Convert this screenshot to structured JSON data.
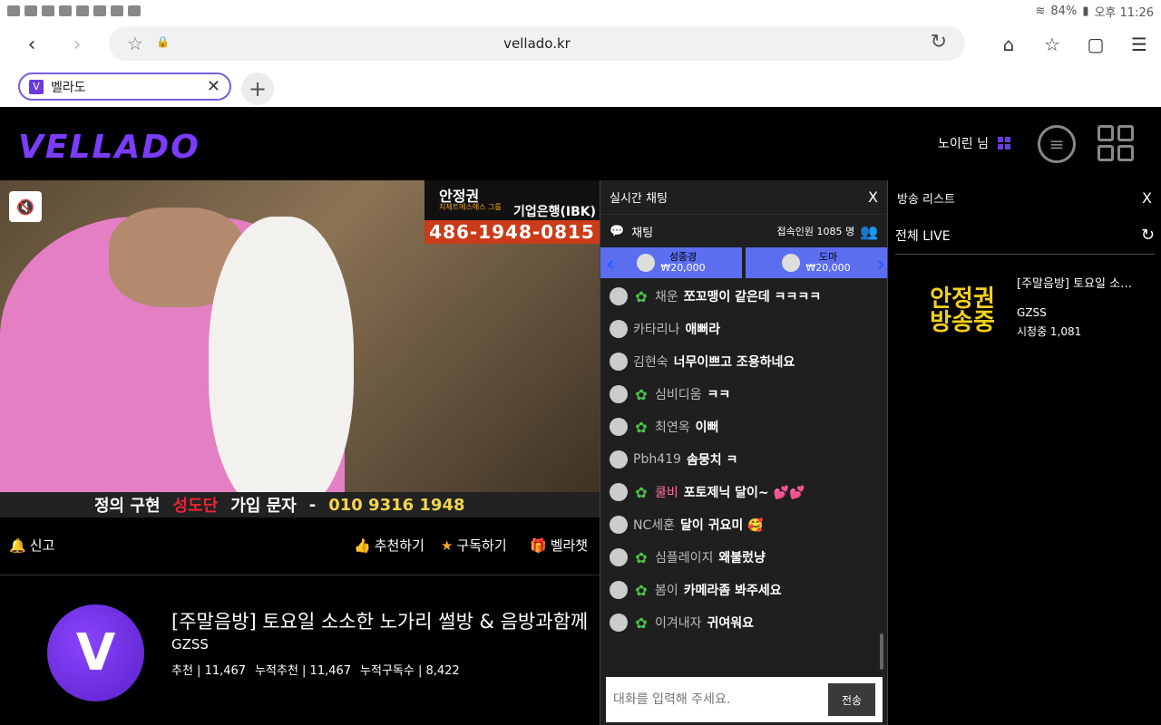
{
  "statusbar": {
    "battery": "84%",
    "time": "오후 11:26"
  },
  "browser": {
    "url": "vellado.kr"
  },
  "tab": {
    "title": "벨라도",
    "favicon": "V"
  },
  "header": {
    "logo": "VELLADO",
    "user": "노이린 님"
  },
  "video": {
    "banner_name": "안정권",
    "banner_sub": "지제트에스에스 그룹",
    "banner_bank": "기업은행(IBK)",
    "banner_phone": "486-1948-0815",
    "bottom_parts": [
      "정의 구현",
      "성도단",
      "가입 문자",
      "-",
      "010  9316  1948"
    ]
  },
  "actions": {
    "report": "신고",
    "recommend": "추천하기",
    "subscribe": "구독하기",
    "gift": "벨라챗"
  },
  "info": {
    "title": "[주말음방] 토요일 소소한 노가리 썰방 & 음방과함께",
    "channel": "GZSS",
    "stats": [
      "추천 | 11,467",
      "누적추천 | 11,467",
      "누적구독수 | 8,422"
    ]
  },
  "chat": {
    "title": "실시간 채팅",
    "close": "X",
    "sub_label": "채팅",
    "count": "접속인원 1085 명",
    "donors": [
      {
        "name": "성종경",
        "amount": "₩20,000"
      },
      {
        "name": "도마",
        "amount": "₩20,000"
      }
    ],
    "messages": [
      {
        "name": "채운",
        "text": "쪼꼬맹이 같은데 ㅋㅋㅋㅋ",
        "badge": true,
        "pink": false
      },
      {
        "name": "카타리나",
        "text": "애뻐라",
        "badge": false,
        "pink": false
      },
      {
        "name": "김현숙",
        "text": "너무이쁘고 조용하네요",
        "badge": false,
        "pink": false
      },
      {
        "name": "심비디움",
        "text": "ㅋㅋ",
        "badge": true,
        "pink": false
      },
      {
        "name": "최연옥",
        "text": "이뻐",
        "badge": true,
        "pink": false
      },
      {
        "name": "Pbh419",
        "text": "솜뭉치 ㅋ",
        "badge": false,
        "pink": false
      },
      {
        "name": "쿨비",
        "text": "포토제닉 달이~ 💕💕",
        "badge": true,
        "pink": true
      },
      {
        "name": "NC세훈",
        "text": "달이 귀요미 🥰",
        "badge": false,
        "pink": false
      },
      {
        "name": "심플레이지",
        "text": "왜불렀냥",
        "badge": true,
        "pink": false
      },
      {
        "name": "봄이",
        "text": "카메라좀 봐주세요",
        "badge": true,
        "pink": false
      },
      {
        "name": "이겨내자",
        "text": "귀여워요",
        "badge": true,
        "pink": false
      }
    ],
    "input_placeholder": "대화를 입력해 주세요.",
    "send": "전송"
  },
  "list": {
    "title": "방송 리스트",
    "close": "X",
    "filter": "전체 LIVE",
    "thumb_lines": [
      "안정권",
      "방송중"
    ],
    "item_title": "[주말음방] 토요일 소…",
    "item_channel": "GZSS",
    "item_viewers": "시청중 1,081"
  }
}
